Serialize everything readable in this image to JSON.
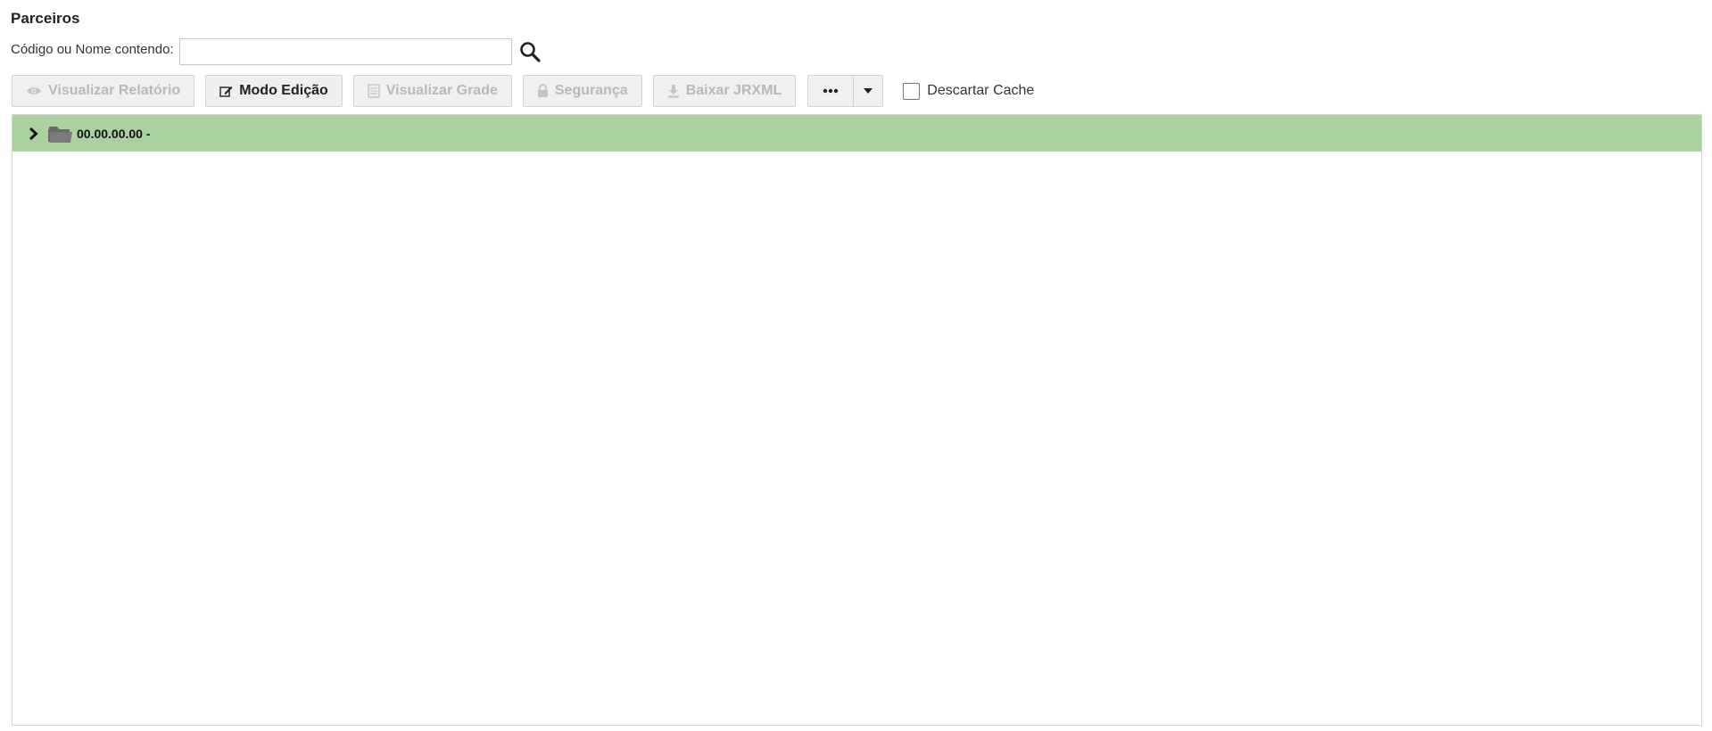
{
  "page": {
    "title": "Parceiros"
  },
  "search": {
    "label": "Código ou Nome contendo:",
    "value": "",
    "placeholder": ""
  },
  "toolbar": {
    "view_report_label": "Visualizar Relatório",
    "edit_mode_label": "Modo Edição",
    "view_grid_label": "Visualizar Grade",
    "security_label": "Segurança",
    "download_jrxml_label": "Baixar JRXML",
    "discard_cache_label": "Descartar Cache",
    "discard_cache_checked": false
  },
  "tree": {
    "nodes": [
      {
        "label": "00.00.00.00 -",
        "expanded": false,
        "icon": "folder-open-icon",
        "selected": true
      }
    ]
  },
  "colors": {
    "selected_row": "#a9d29e",
    "disabled_text": "#b8b8b8"
  }
}
